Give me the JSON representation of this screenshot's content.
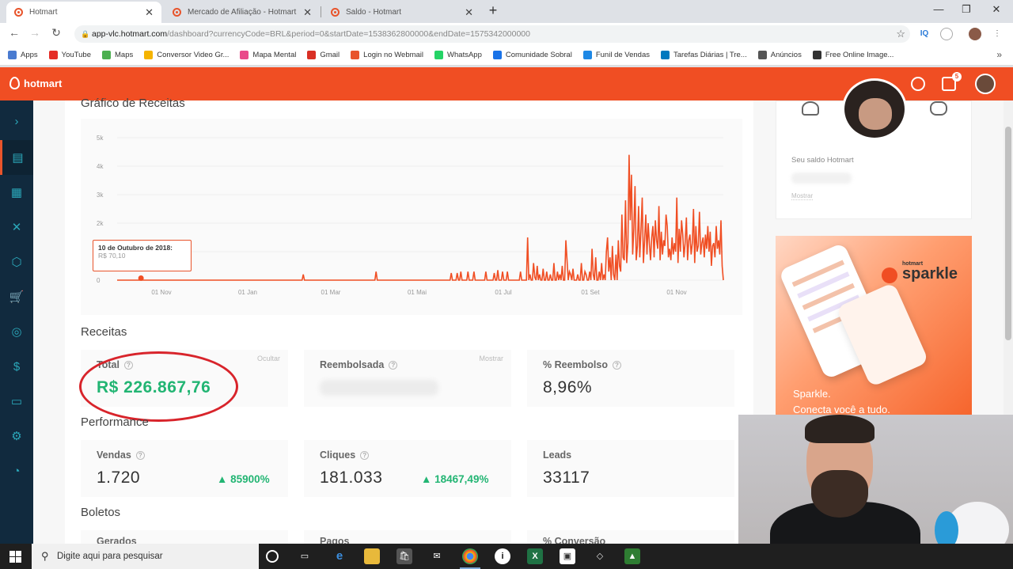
{
  "browser": {
    "tabs": [
      {
        "title": "Hotmart",
        "active": true
      },
      {
        "title": "Mercado de Afiliação - Hotmart",
        "active": false
      },
      {
        "title": "Saldo - Hotmart",
        "active": false
      }
    ],
    "url_host": "app-vlc.hotmart.com",
    "url_path": "/dashboard?currencyCode=BRL&period=0&startDate=1538362800000&endDate=1575342000000",
    "bookmarks": [
      "Apps",
      "YouTube",
      "Maps",
      "Conversor Video Gr...",
      "Mapa Mental",
      "Gmail",
      "Login no Webmail",
      "WhatsApp",
      "Comunidade Sobral",
      "Funil de Vendas",
      "Tarefas Diárias | Tre...",
      "Anúncios",
      "Free Online Image..."
    ],
    "bookmark_colors": [
      "#4a7bd0",
      "#e52d27",
      "#4caf50",
      "#f5b400",
      "#e94a8a",
      "#d93025",
      "#e8542b",
      "#25d366",
      "#1a73e8",
      "#1e88e5",
      "#0079bf",
      "#555555",
      "#333333"
    ]
  },
  "hotmart": {
    "brand": "hotmart",
    "brand_color": "#f04e23",
    "notifications": "5",
    "sidebar_icons": [
      "chevron-right-icon",
      "dashboard-icon",
      "grid-icon",
      "network-icon",
      "box-icon",
      "cart-icon",
      "chat-icon",
      "dollar-icon",
      "document-icon",
      "gear-icon",
      "analytics-icon"
    ]
  },
  "dashboard": {
    "chart_title": "Gráfico de Receitas",
    "tooltip_date": "10 de Outubro de 2018:",
    "tooltip_value": "R$ 70,10",
    "receitas_title": "Receitas",
    "total_label": "Total",
    "total_value": "R$ 226.867,76",
    "ocultar": "Ocultar",
    "reembolsada_label": "Reembolsada",
    "mostrar": "Mostrar",
    "perc_reembolso_label": "% Reembolso",
    "perc_reembolso_value": "8,96%",
    "performance_title": "Performance",
    "vendas_label": "Vendas",
    "vendas_value": "1.720",
    "vendas_delta": "85900%",
    "cliques_label": "Cliques",
    "cliques_value": "181.033",
    "cliques_delta": "18467,49%",
    "leads_label": "Leads",
    "leads_value": "33117",
    "boletos_title": "Boletos",
    "boletos_cols": [
      "Gerados",
      "Pagos",
      "% Conversão"
    ]
  },
  "right_panel": {
    "saldo_label": "Seu saldo Hotmart",
    "mostrar": "Mostrar",
    "banner_brand_small": "hotmart",
    "banner_brand": "sparkle",
    "banner_caption_1": "Sparkle.",
    "banner_caption_2": "Conecta você a tudo."
  },
  "taskbar": {
    "search_placeholder": "Digite aqui para pesquisar"
  },
  "chart_data": {
    "type": "line",
    "title": "Gráfico de Receitas",
    "y_ticks": [
      "0",
      "1k",
      "2k",
      "3k",
      "4k",
      "5k"
    ],
    "ylim": [
      0,
      5000
    ],
    "x_ticks": [
      "01 Nov",
      "01 Jan",
      "01 Mar",
      "01 Mai",
      "01 Jul",
      "01 Set",
      "01 Nov"
    ],
    "color": "#f04e23",
    "series": [
      {
        "values": [
          0,
          0,
          0,
          0,
          0,
          0,
          0,
          0,
          0,
          0,
          0,
          0,
          0,
          0,
          0,
          0,
          0,
          0,
          0,
          0,
          70,
          0,
          0,
          0,
          0,
          0,
          0,
          0,
          0,
          0,
          0,
          0,
          0,
          0,
          0,
          0,
          0,
          0,
          0,
          0,
          0,
          0,
          0,
          0,
          0,
          0,
          0,
          0,
          0,
          0,
          0,
          0,
          0,
          0,
          0,
          0,
          0,
          0,
          0,
          0,
          0,
          0,
          0,
          0,
          0,
          0,
          0,
          0,
          0,
          0,
          0,
          0,
          0,
          0,
          0,
          0,
          0,
          0,
          0,
          0,
          0,
          0,
          0,
          0,
          0,
          0,
          0,
          0,
          0,
          0,
          0,
          0,
          0,
          0,
          0,
          0,
          0,
          0,
          0,
          0,
          0,
          0,
          0,
          0,
          0,
          0,
          0,
          0,
          0,
          0,
          0,
          0,
          0,
          0,
          0,
          0,
          0,
          0,
          0,
          0,
          0,
          0,
          0,
          0,
          0,
          0,
          0,
          0,
          0,
          0,
          0,
          0,
          0,
          0,
          0,
          0,
          0,
          0,
          0,
          0,
          0,
          0,
          0,
          0,
          0,
          0,
          0,
          0,
          0,
          0,
          0,
          0,
          0,
          0,
          0,
          0,
          200,
          0,
          0,
          0,
          0,
          0,
          0,
          0,
          0,
          0,
          0,
          0,
          0,
          0,
          0,
          0,
          0,
          0,
          0,
          0,
          0,
          0,
          0,
          0,
          0,
          0,
          0,
          0,
          0,
          0,
          0,
          0,
          0,
          0,
          0,
          0,
          0,
          0,
          0,
          0,
          0,
          0,
          0,
          0,
          0,
          0,
          0,
          0,
          0,
          0,
          0,
          0,
          0,
          0,
          0,
          0,
          0,
          0,
          0,
          0,
          0,
          300,
          0,
          0,
          0,
          0,
          0,
          0,
          0,
          0,
          0,
          0,
          0,
          0,
          0,
          0,
          0,
          0,
          0,
          0,
          0,
          0,
          0,
          0,
          0,
          0,
          0,
          0,
          0,
          0,
          0,
          0,
          0,
          0,
          0,
          0,
          0,
          0,
          0,
          0,
          0,
          0,
          0,
          0,
          0,
          0,
          0,
          0,
          0,
          0,
          0,
          0,
          0,
          0,
          0,
          0,
          0,
          0,
          0,
          0,
          0,
          0,
          0,
          0,
          250,
          0,
          0,
          0,
          0,
          250,
          0,
          0,
          300,
          0,
          0,
          0,
          0,
          0,
          300,
          0,
          0,
          0,
          0,
          300,
          0,
          0,
          0,
          0,
          0,
          0,
          0,
          0,
          0,
          300,
          0,
          0,
          0,
          0,
          0,
          0,
          250,
          0,
          0,
          350,
          0,
          0,
          0,
          300,
          0,
          0,
          0,
          300,
          0,
          0,
          0,
          0,
          0,
          0,
          0,
          0,
          0,
          0,
          300,
          0,
          0,
          0,
          0,
          0,
          1500,
          0,
          200,
          0,
          0,
          600,
          100,
          0,
          500,
          0,
          200,
          0,
          0,
          400,
          0,
          0,
          300,
          0,
          0,
          200,
          0,
          0,
          600,
          0,
          0,
          300,
          0,
          200,
          0,
          500,
          0,
          0,
          1400,
          700,
          0,
          300,
          200,
          0,
          400,
          0,
          0,
          0,
          200,
          0,
          0,
          600,
          0,
          0,
          300,
          200,
          0,
          0,
          300,
          0,
          1100,
          200,
          0,
          800,
          0,
          0,
          300,
          0,
          600,
          0,
          200,
          0,
          1000,
          1500,
          300,
          800,
          0,
          1200,
          200,
          0,
          900,
          0,
          1400,
          500,
          300,
          2300,
          800,
          700,
          2800,
          600,
          1300,
          4400,
          2100,
          3700,
          900,
          1800,
          3300,
          700,
          1200,
          2600,
          800,
          1800,
          2900,
          600,
          1400,
          2300,
          900,
          2000,
          1300,
          700,
          1500,
          1900,
          800,
          2100,
          1400,
          1100,
          2600,
          700,
          1700,
          900,
          1400,
          1200,
          2300,
          1900,
          800,
          1100,
          700,
          1500,
          900,
          1300,
          1000,
          2900,
          600,
          1800,
          1000,
          2100,
          1600,
          800,
          1300,
          2200,
          700,
          1400,
          1600,
          900,
          1300,
          2500,
          600,
          1900,
          1000,
          1200,
          2400,
          900,
          1300,
          1500,
          800,
          1600,
          1100,
          1900,
          1000,
          1700,
          500,
          1200,
          1300,
          800,
          1900,
          1100,
          1400,
          900,
          2100,
          500,
          0
        ]
      }
    ]
  }
}
